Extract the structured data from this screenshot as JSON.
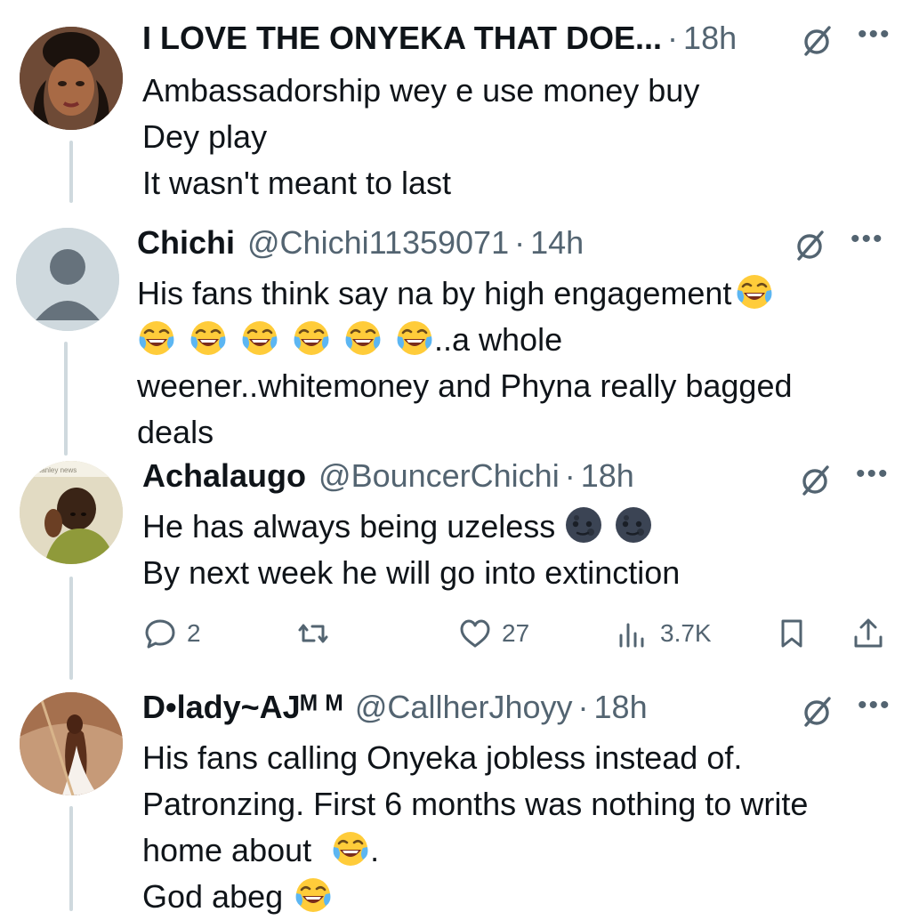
{
  "tweets": [
    {
      "name": "I LOVE THE ONYEKA THAT DOE...",
      "handle": "",
      "time": "18h",
      "lines": [
        "Ambassadorship wey e use money buy",
        "Dey play",
        "It wasn't meant to last"
      ]
    },
    {
      "name": "Chichi",
      "handle": "@Chichi11359071",
      "time": "14h",
      "lines": [
        "His fans think say na by high engagement",
        "..a whole",
        "weener..whitemoney and Phyna really bagged",
        "deals"
      ]
    },
    {
      "name": "Achalaugo",
      "handle": "@BouncerChichi",
      "time": "18h",
      "lines": [
        "He has always being uzeless",
        "By next week he will go into extinction"
      ],
      "avatar_caption": "ey Stanley news",
      "actions": {
        "replies": "2",
        "reposts": "",
        "likes": "27",
        "views": "3.7K"
      }
    },
    {
      "name": "D•lady~AJᴹ ᴹ",
      "handle": "@CallherJhoyy",
      "time": "18h",
      "lines": [
        "His fans calling Onyeka jobless instead of.",
        "Patronzing. First 6 months was nothing to write",
        "home about",
        ".",
        "God abeg"
      ]
    }
  ],
  "icons": {
    "grok": "grok-slash-icon",
    "more": "more-dots-icon",
    "laugh": "face-with-tears-of-joy-emoji",
    "moon": "new-moon-face-emoji",
    "reply": "reply-icon",
    "repost": "repost-icon",
    "like": "like-heart-icon",
    "views": "views-bars-icon",
    "bookmark": "bookmark-icon",
    "share": "share-icon"
  },
  "colors": {
    "text": "#0f1419",
    "secondary": "#536471",
    "thread_line": "#cfd9de"
  }
}
